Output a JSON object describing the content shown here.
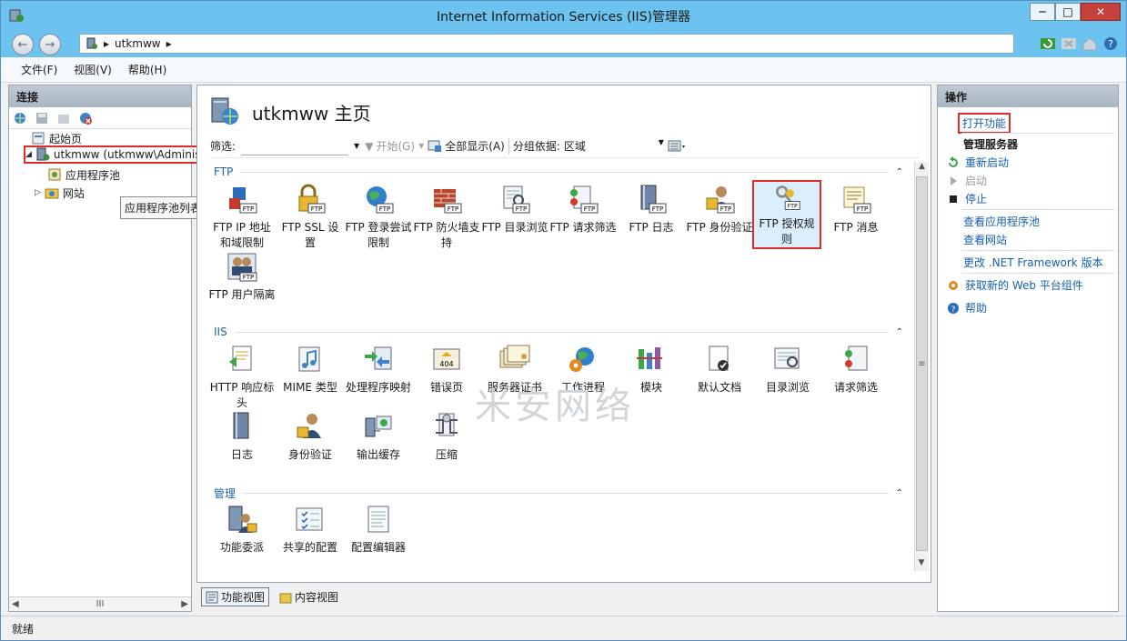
{
  "window": {
    "title": "Internet Information Services (IIS)管理器",
    "min_label": "─",
    "max_label": "□",
    "close_label": "✕"
  },
  "address": {
    "crumbs": [
      "utkmww"
    ],
    "sep": "▸"
  },
  "menu": [
    "文件(F)",
    "视图(V)",
    "帮助(H)"
  ],
  "left": {
    "header": "连接",
    "tree": [
      {
        "label": "起始页"
      },
      {
        "label": "utkmww (utkmww\\Adminis"
      },
      {
        "label": "应用程序池"
      },
      {
        "label": "网站"
      }
    ],
    "tooltip": "应用程序池列表",
    "hscroll_mid": "III"
  },
  "center": {
    "title": "utkmww 主页",
    "filter_label": "筛选:",
    "go_label": "开始(G)",
    "showall_label": "全部显示(A)",
    "group_label": "分组依据:",
    "group_value": "区域",
    "sections": [
      {
        "name": "FTP",
        "features": [
          "FTP IP 地址和域限制",
          "FTP SSL 设置",
          "FTP 登录尝试限制",
          "FTP 防火墙支持",
          "FTP 目录浏览",
          "FTP 请求筛选",
          "FTP 日志",
          "FTP 身份验证",
          "FTP 授权规则",
          "FTP 消息",
          "FTP 用户隔离"
        ]
      },
      {
        "name": "IIS",
        "features": [
          "HTTP 响应标头",
          "MIME 类型",
          "处理程序映射",
          "错误页",
          "服务器证书",
          "工作进程",
          "模块",
          "默认文档",
          "目录浏览",
          "请求筛选",
          "日志",
          "身份验证",
          "输出缓存",
          "压缩"
        ]
      },
      {
        "name": "管理",
        "features": [
          "功能委派",
          "共享的配置",
          "配置编辑器"
        ]
      }
    ],
    "watermark": "米安网络",
    "scroll_mid": "≡"
  },
  "bottom_tabs": [
    "功能视图",
    "内容视图"
  ],
  "right": {
    "header": "操作",
    "open_feature": "打开功能",
    "manage_server": "管理服务器",
    "restart": "重新启动",
    "start": "启动",
    "stop": "停止",
    "view_apppools": "查看应用程序池",
    "view_sites": "查看网站",
    "change_net": "更改 .NET Framework 版本",
    "get_web": "获取新的 Web 平台组件",
    "help": "帮助"
  },
  "status": "就绪",
  "colors": {
    "titlebar": "#6cc3ef",
    "highlight_border": "#e12a2a",
    "link": "#1560b0"
  }
}
